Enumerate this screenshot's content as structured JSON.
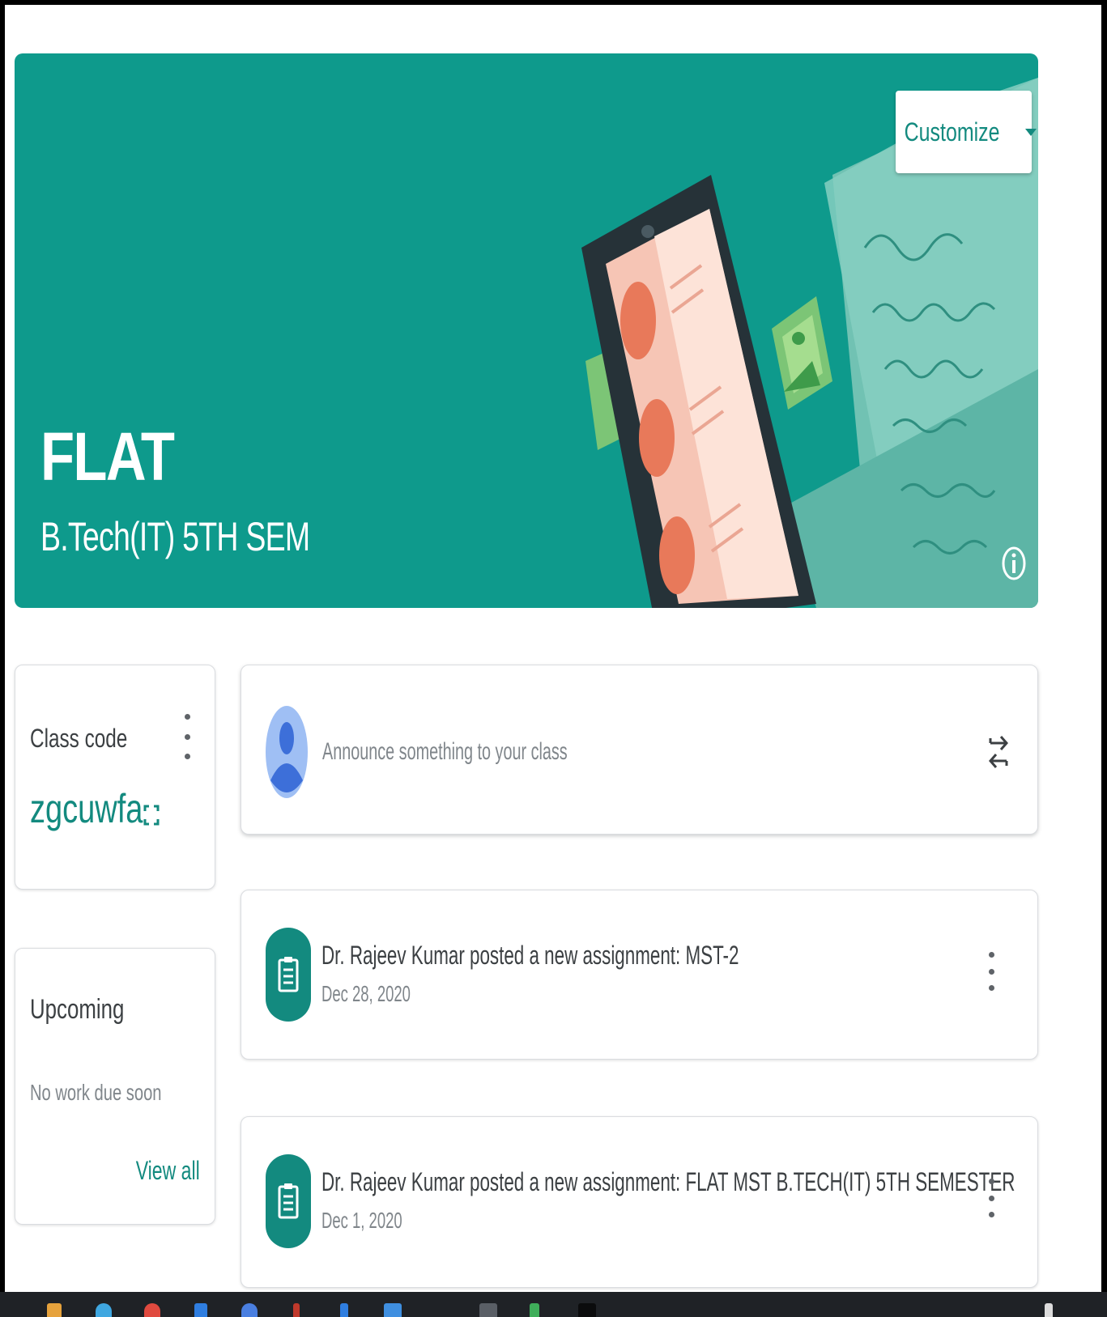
{
  "banner": {
    "class_name": "FLAT",
    "section": "B.Tech(IT) 5TH SEM",
    "customize_label": "Customize",
    "background_color": "#0e9a8c"
  },
  "class_code": {
    "heading": "Class code",
    "code": "zgcuwfa"
  },
  "upcoming": {
    "heading": "Upcoming",
    "empty_text": "No work due soon",
    "view_all_label": "View all"
  },
  "stream": {
    "announce_placeholder": "Announce something to your class",
    "posts": [
      {
        "title": "Dr. Rajeev Kumar posted a new assignment: MST-2",
        "date": "Dec 28, 2020"
      },
      {
        "title": "Dr. Rajeev Kumar posted a new assignment: FLAT MST B.TECH(IT) 5TH SEMESTER",
        "date": "Dec 1, 2020"
      }
    ]
  },
  "colors": {
    "accent": "#138a7f",
    "avatar": "#4a7fe0"
  },
  "icons": [
    "caret-down-icon",
    "info-icon",
    "more-vert-icon",
    "fullscreen-icon",
    "avatar-icon",
    "repost-icon",
    "assignment-icon"
  ]
}
